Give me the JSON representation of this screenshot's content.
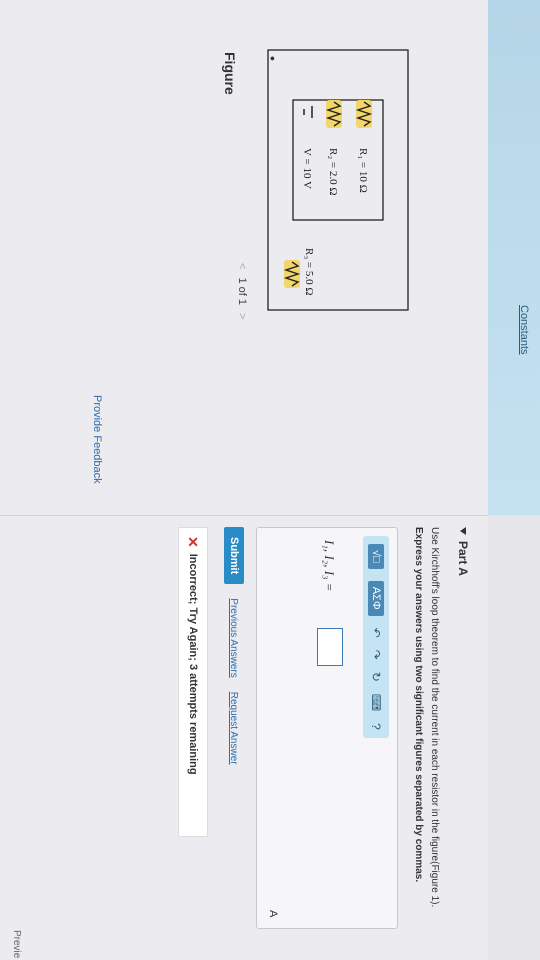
{
  "header": {
    "constants_label": "Constants"
  },
  "left_panel": {
    "figure_title": "Figure",
    "pager": {
      "prev": "<",
      "label": "1 of 1",
      "next": ">"
    },
    "circuit": {
      "r1_label": "R₁ = 10 Ω",
      "r2_label": "R₂ = 2.0 Ω",
      "r3_label": "R₃ = 5.0 Ω",
      "v_label": "V = 10 V"
    },
    "feedback": "Provide Feedback"
  },
  "part_a": {
    "title": "Part A",
    "instruction": "Use Kirchhoff's loop theorem to find the current in each resistor in the figure(Figure 1).",
    "express": "Express your answers using two significant figures separated by commas.",
    "answer_label": "I₁, I₂, I₃ =",
    "unit": "A",
    "toolbar": {
      "templates": "√□",
      "symbols": "ΑΣΦ"
    },
    "submit": "Submit",
    "previous_answers": "Previous Answers",
    "request_answer": "Request Answer",
    "incorrect_message": "Incorrect; Try Again; 3 attempts remaining"
  },
  "corner_label": "Previe"
}
